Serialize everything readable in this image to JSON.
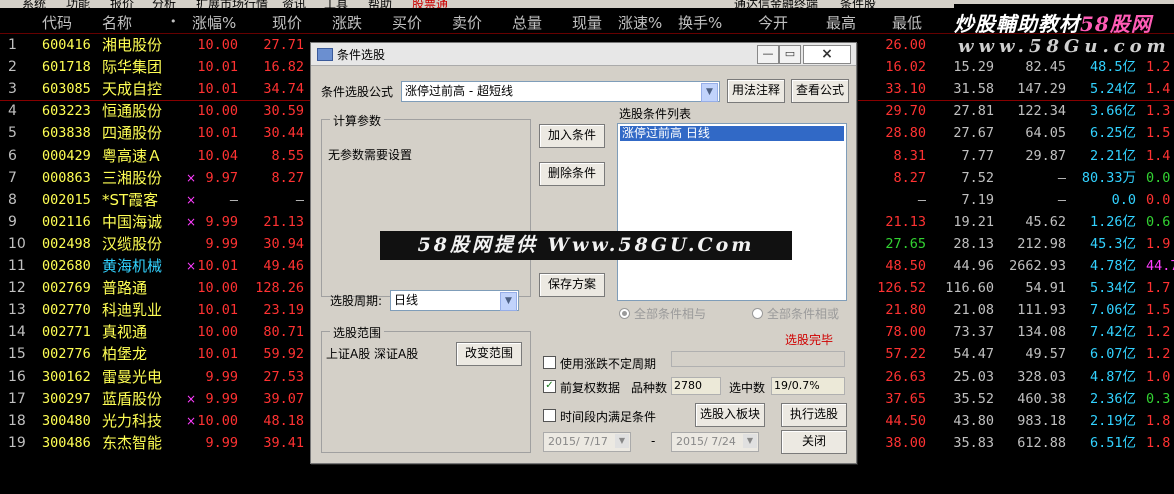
{
  "menu": [
    "系统",
    "功能",
    "报价",
    "分析",
    "扩展市场行情",
    "资讯",
    "工具",
    "帮助",
    "股票通",
    "通达信金融终端",
    "条件股"
  ],
  "brand": {
    "text_a": "炒股輔助教材",
    "text_b": "58股网",
    "url": "www.58Gu.com"
  },
  "columns": [
    "代码",
    "名称",
    "•",
    "涨幅%",
    "现价",
    "涨跌",
    "买价",
    "卖价",
    "总量",
    "现量",
    "涨速%",
    "换手%",
    "今开",
    "最高",
    "最低"
  ],
  "rows": [
    {
      "idx": "1",
      "code": "600416",
      "name": "湘电股份",
      "mark": "",
      "pct": "10.00",
      "price": "27.71",
      "low": "26.00",
      "c1": "",
      "c2": "",
      "c3": "",
      "c4": ""
    },
    {
      "idx": "2",
      "code": "601718",
      "name": "际华集团",
      "mark": "",
      "pct": "10.01",
      "price": "16.82",
      "low": "16.02",
      "c1": "15.29",
      "c2": "82.45",
      "c3": "48.5亿",
      "c4": "1.2"
    },
    {
      "idx": "3",
      "code": "603085",
      "name": "天成自控",
      "mark": "",
      "pct": "10.01",
      "price": "34.74",
      "low": "33.10",
      "c1": "31.58",
      "c2": "147.29",
      "c3": "5.24亿",
      "c4": "1.4"
    },
    {
      "idx": "4",
      "code": "603223",
      "name": "恒通股份",
      "mark": "",
      "pct": "10.00",
      "price": "30.59",
      "low": "29.70",
      "c1": "27.81",
      "c2": "122.34",
      "c3": "3.66亿",
      "c4": "1.3"
    },
    {
      "idx": "5",
      "code": "603838",
      "name": "四通股份",
      "mark": "",
      "pct": "10.01",
      "price": "30.44",
      "low": "28.80",
      "c1": "27.67",
      "c2": "64.05",
      "c3": "6.25亿",
      "c4": "1.5"
    },
    {
      "idx": "6",
      "code": "000429",
      "name": "粤高速Ａ",
      "mark": "",
      "pct": "10.04",
      "price": "8.55",
      "low": "8.31",
      "c1": "7.77",
      "c2": "29.87",
      "c3": "2.21亿",
      "c4": "1.4"
    },
    {
      "idx": "7",
      "code": "000863",
      "name": "三湘股份",
      "mark": "×",
      "pct": "9.97",
      "price": "8.27",
      "low": "8.27",
      "c1": "7.52",
      "c2": "—",
      "c3": "80.33万",
      "c4": "0.0"
    },
    {
      "idx": "8",
      "code": "002015",
      "name": "*ST霞客",
      "mark": "×",
      "pct": "—",
      "price": "—",
      "low": "—",
      "c1": "7.19",
      "c2": "—",
      "c3": "0.0",
      "c4": "0.0"
    },
    {
      "idx": "9",
      "code": "002116",
      "name": "中国海诚",
      "mark": "×",
      "pct": "9.99",
      "price": "21.13",
      "low": "21.13",
      "c1": "19.21",
      "c2": "45.62",
      "c3": "1.26亿",
      "c4": "0.6"
    },
    {
      "idx": "10",
      "code": "002498",
      "name": "汉缆股份",
      "mark": "",
      "pct": "9.99",
      "price": "30.94",
      "low": "27.65",
      "c1": "28.13",
      "c2": "212.98",
      "c3": "45.3亿",
      "c4": "1.9"
    },
    {
      "idx": "11",
      "code": "002680",
      "name": "黄海机械",
      "mark": "×",
      "pct": "10.01",
      "price": "49.46",
      "low": "48.50",
      "c1": "44.96",
      "c2": "2662.93",
      "c3": "4.78亿",
      "c4": "44.7"
    },
    {
      "idx": "12",
      "code": "002769",
      "name": "普路通",
      "mark": "",
      "pct": "10.00",
      "price": "128.26",
      "low": "126.52",
      "c1": "116.60",
      "c2": "54.91",
      "c3": "5.34亿",
      "c4": "1.7"
    },
    {
      "idx": "13",
      "code": "002770",
      "name": "科迪乳业",
      "mark": "",
      "pct": "10.01",
      "price": "23.19",
      "low": "21.80",
      "c1": "21.08",
      "c2": "111.93",
      "c3": "7.06亿",
      "c4": "1.5"
    },
    {
      "idx": "14",
      "code": "002771",
      "name": "真视通",
      "mark": "",
      "pct": "10.00",
      "price": "80.71",
      "low": "78.00",
      "c1": "73.37",
      "c2": "134.08",
      "c3": "7.42亿",
      "c4": "1.2"
    },
    {
      "idx": "15",
      "code": "002776",
      "name": "柏堡龙",
      "mark": "",
      "pct": "10.01",
      "price": "59.92",
      "low": "57.22",
      "c1": "54.47",
      "c2": "49.57",
      "c3": "6.07亿",
      "c4": "1.2"
    },
    {
      "idx": "16",
      "code": "300162",
      "name": "雷曼光电",
      "mark": "",
      "pct": "9.99",
      "price": "27.53",
      "low": "26.63",
      "c1": "25.03",
      "c2": "328.03",
      "c3": "4.87亿",
      "c4": "1.0"
    },
    {
      "idx": "17",
      "code": "300297",
      "name": "蓝盾股份",
      "mark": "×",
      "pct": "9.99",
      "price": "39.07",
      "low": "37.65",
      "c1": "35.52",
      "c2": "460.38",
      "c3": "2.36亿",
      "c4": "0.3"
    },
    {
      "idx": "18",
      "code": "300480",
      "name": "光力科技",
      "mark": "×",
      "pct": "10.00",
      "price": "48.18",
      "low": "44.50",
      "c1": "43.80",
      "c2": "983.18",
      "c3": "2.19亿",
      "c4": "1.8"
    },
    {
      "idx": "19",
      "code": "300486",
      "name": "东杰智能",
      "mark": "",
      "pct": "9.99",
      "price": "39.41",
      "low": "38.00",
      "c1": "35.83",
      "c2": "612.88",
      "c3": "6.51亿",
      "c4": "1.8"
    }
  ],
  "dialog": {
    "title": "条件选股",
    "formula_label": "条件选股公式",
    "formula_value": "涨停过前高   - 超短线",
    "btn_usage": "用法注释",
    "btn_view": "查看公式",
    "params_title": "计算参数",
    "params_note": "无参数需要设置",
    "btn_add": "加入条件",
    "btn_delete": "删除条件",
    "btn_save": "保存方案",
    "list_title": "选股条件列表",
    "list_items": [
      "涨停过前高   日线"
    ],
    "period_label": "选股周期:",
    "period_value": "日线",
    "radio_and": "全部条件相与",
    "radio_or": "全部条件相或",
    "range_title": "选股范围",
    "range_text": "上证A股  深证A股",
    "btn_change_range": "改变范围",
    "status": "选股完毕",
    "chk_period": "使用涨跌不定周期",
    "chk_adjust": "前复权数据",
    "count_label": "品种数",
    "count_value": "2780",
    "hit_label": "选中数",
    "hit_value": "19/0.7%",
    "chk_time": "时间段内满足条件",
    "btn_to_block": "选股入板块",
    "btn_run": "执行选股",
    "date_from": "2015/ 7/17",
    "date_to": "2015/ 7/24",
    "date_dash": "-",
    "btn_close": "关闭"
  },
  "watermark": "58股网提供  Www.58GU.Com",
  "colors": {
    "bg": "#000000",
    "code": "#ffff54",
    "up": "#ff3232",
    "green": "#32d232",
    "cyan": "#32d2ff",
    "dialog": "#d4d0c8"
  }
}
